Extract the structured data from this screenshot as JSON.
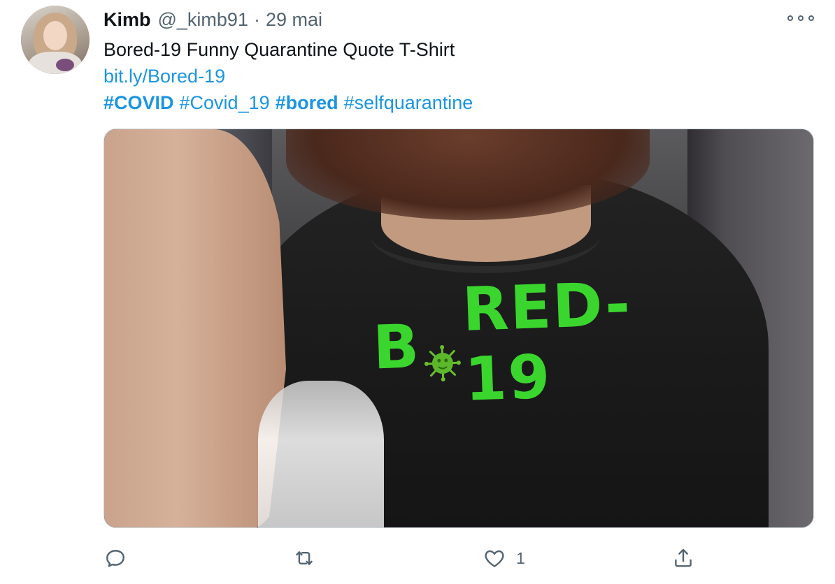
{
  "tweet": {
    "author_name": "Kimb",
    "author_handle": "@_kimb91",
    "separator": "·",
    "date": "29 mai",
    "text": "Bored-19 Funny Quarantine Quote T-Shirt",
    "link": "bit.ly/Bored-19",
    "hashtags": [
      {
        "text": "#COVID",
        "bold": true
      },
      {
        "text": "#Covid_19",
        "bold": false
      },
      {
        "text": "#bored",
        "bold": true
      },
      {
        "text": "#selfquarantine",
        "bold": false
      }
    ],
    "media": {
      "print_text_start": "B",
      "print_text_end": "RED-19",
      "print_color": "#3ad62e"
    },
    "actions": {
      "reply_icon": "reply-icon",
      "retweet_icon": "retweet-icon",
      "like_icon": "heart-icon",
      "like_count": "1",
      "share_icon": "share-icon"
    }
  },
  "colors": {
    "link": "#1b95e0",
    "secondary_text": "#536471",
    "primary_text": "#0f1419"
  }
}
